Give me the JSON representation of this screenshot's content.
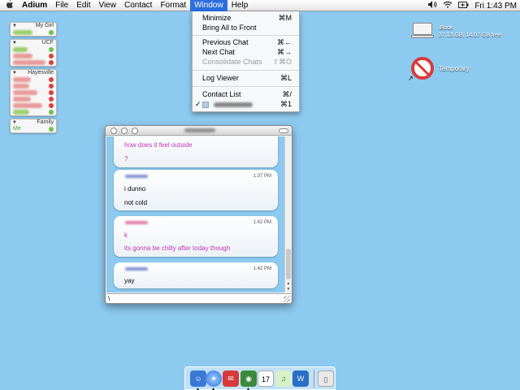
{
  "menubar": {
    "apple": "",
    "app_name": "Adium",
    "menus": [
      "File",
      "Edit",
      "View",
      "Contact",
      "Format",
      "Window",
      "Help"
    ],
    "clock": "Fri 1:43 PM"
  },
  "window_menu": {
    "items": [
      {
        "label": "Minimize",
        "shortcut": "⌘M",
        "enabled": true
      },
      {
        "label": "Bring All to Front",
        "shortcut": "",
        "enabled": true
      },
      {
        "label": "Previous Chat",
        "shortcut": "⌘←",
        "enabled": true
      },
      {
        "label": "Next Chat",
        "shortcut": "⌘→",
        "enabled": true
      },
      {
        "label": "Consolidate Chats",
        "shortcut": "⇧⌘O",
        "enabled": false
      },
      {
        "label": "Log Viewer",
        "shortcut": "⌘L",
        "enabled": true
      },
      {
        "label": "Contact List",
        "shortcut": "⌘/",
        "enabled": true
      },
      {
        "label": "",
        "shortcut": "⌘1",
        "enabled": true,
        "checked": "✓"
      }
    ]
  },
  "contact_list": {
    "groups": [
      {
        "name": "My Girl",
        "contacts": [
          {
            "status": "online",
            "color": "#9ccf6e"
          }
        ]
      },
      {
        "name": "UCF",
        "contacts": [
          {
            "status": "online",
            "color": "#9ccf6e"
          },
          {
            "status": "away",
            "color": "#e89a9a"
          },
          {
            "status": "away",
            "color": "#e89a9a"
          }
        ]
      },
      {
        "name": "Hayesville",
        "contacts": [
          {
            "status": "away",
            "color": "#e89a9a"
          },
          {
            "status": "away",
            "color": "#e89a9a"
          },
          {
            "status": "away",
            "color": "#e89a9a"
          },
          {
            "status": "away",
            "color": "#e89a9a"
          },
          {
            "status": "away",
            "color": "#e89a9a"
          },
          {
            "status": "online",
            "color": "#9ccf6e"
          }
        ]
      },
      {
        "name": "Family",
        "contacts": [
          {
            "name": "Me",
            "status": "online"
          }
        ]
      }
    ]
  },
  "desktop": {
    "disk_name": "iBook",
    "disk_info": "37.13 GB, 14.07 GB free",
    "folder_name": "Temporary"
  },
  "chat": {
    "messages": [
      {
        "sender_color": "#e07aa8",
        "time": "",
        "lines": [
          "how does it feel outside",
          "?"
        ],
        "style": "pink"
      },
      {
        "sender_color": "#7d8fd0",
        "time": "1:37 PM",
        "lines": [
          "i dunno",
          "not cold"
        ],
        "style": "black"
      },
      {
        "sender_color": "#e07aa8",
        "time": "1:42 PM",
        "lines": [
          "k",
          "its gonna be chilly after today though"
        ],
        "style": "pink"
      },
      {
        "sender_color": "#7d8fd0",
        "time": "1:42 PM",
        "lines": [
          "yay"
        ],
        "style": "black"
      }
    ],
    "input_value": "\\"
  },
  "dock": {
    "items": [
      "finder-icon",
      "safari-icon",
      "mail-icon",
      "adium-icon",
      "ical-icon",
      "itunes-icon",
      "word-icon",
      "trash-icon"
    ],
    "ical_day": "17"
  },
  "colors": {
    "desktop": "#8dcaf0",
    "highlight": "#2c6ee0",
    "incoming_text": "#c238b0"
  }
}
